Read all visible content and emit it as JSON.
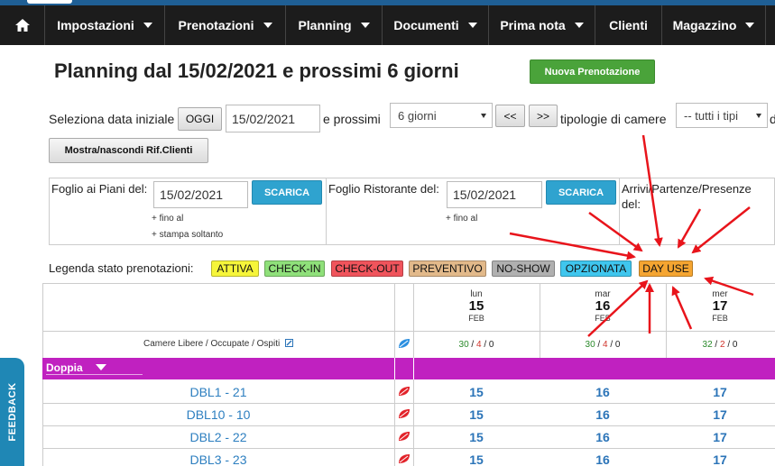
{
  "nav": {
    "items": [
      {
        "label": "Impostazioni",
        "dropdown": true
      },
      {
        "label": "Prenotazioni",
        "dropdown": true
      },
      {
        "label": "Planning",
        "dropdown": true
      },
      {
        "label": "Documenti",
        "dropdown": true
      },
      {
        "label": "Prima nota",
        "dropdown": true
      },
      {
        "label": "Clienti",
        "dropdown": false
      },
      {
        "label": "Magazzino",
        "dropdown": true
      }
    ]
  },
  "page": {
    "title": "Planning dal 15/02/2021 e prossimi 6 giorni",
    "new_booking_label": "Nuova Prenotazione"
  },
  "controls": {
    "start_date_label": "Seleziona data iniziale",
    "today_button": "OGGI",
    "start_date_value": "15/02/2021",
    "next_label": "e prossimi",
    "days_select_value": "6 giorni",
    "prev_button": "<<",
    "next_button": ">>",
    "room_types_label": "tipologie di camere",
    "room_types_value": "-- tutti i tipi",
    "toggle_client_refs": "Mostra/nascondi Rif.Clienti"
  },
  "sheets": {
    "floor": {
      "label": "Foglio ai Piani del:",
      "date": "15/02/2021",
      "button": "SCARICA",
      "note1": "+ fino al",
      "note2": "+ stampa soltanto"
    },
    "restaurant": {
      "label": "Foglio Ristorante del:",
      "date": "15/02/2021",
      "button": "SCARICA",
      "note1": "+ fino al"
    },
    "presence": {
      "label": "Arrivi/Partenze/Presenze del:"
    }
  },
  "legend": {
    "label": "Legenda stato prenotazioni:",
    "items": [
      {
        "label": "ATTIVA",
        "color": "#f6f53a"
      },
      {
        "label": "CHECK-IN",
        "color": "#8fe07a"
      },
      {
        "label": "CHECK-OUT",
        "color": "#f0545c"
      },
      {
        "label": "PREVENTIVO",
        "color": "#e2b98a"
      },
      {
        "label": "NO-SHOW",
        "color": "#b0b0b0"
      },
      {
        "label": "OPZIONATA",
        "color": "#3fc6ee"
      },
      {
        "label": "DAY USE",
        "color": "#f5a531"
      }
    ]
  },
  "planning": {
    "summary_label": "Camere Libere / Occupate / Ospiti",
    "days": [
      {
        "dow": "lun",
        "day": "15",
        "month": "FEB",
        "free": "30",
        "occupied": "4",
        "guests": "0"
      },
      {
        "dow": "mar",
        "day": "16",
        "month": "FEB",
        "free": "30",
        "occupied": "4",
        "guests": "0"
      },
      {
        "dow": "mer",
        "day": "17",
        "month": "FEB",
        "free": "32",
        "occupied": "2",
        "guests": "0"
      }
    ],
    "group": "Doppia",
    "rooms": [
      "DBL1 - 21",
      "DBL10 - 10",
      "DBL2 - 22",
      "DBL3 - 23"
    ]
  },
  "feedback_label": "FEEDBACK",
  "colors": {
    "navbar": "#1c1c1c",
    "accent_blue": "#2fa3cf",
    "green": "#4aa33a",
    "group_bar": "#c021c0",
    "annotation_arrow": "#e8141b"
  }
}
